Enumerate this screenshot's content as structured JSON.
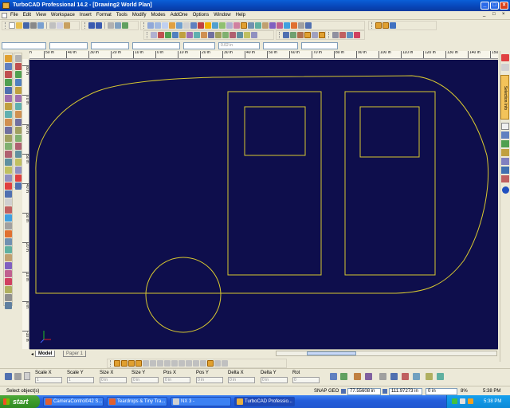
{
  "window": {
    "title": "TurboCAD Professional 14.2 - [Drawing2 World Plan]",
    "controls": [
      "_",
      "□",
      "×"
    ]
  },
  "menubar": {
    "items": [
      "File",
      "Edit",
      "View",
      "Workspace",
      "Insert",
      "Format",
      "Tools",
      "Modify",
      "Modes",
      "AddOne",
      "Options",
      "Window",
      "Help"
    ],
    "doc_controls": [
      "_",
      "□",
      "×"
    ]
  },
  "fields": {
    "linewidth": "0.02 in"
  },
  "ruler": {
    "h_labels": [
      "60 in",
      "50 in",
      "40 in",
      "30 in",
      "20 in",
      "10 in",
      "0 in",
      "10 in",
      "20 in",
      "30 in",
      "40 in",
      "50 in",
      "60 in",
      "70 in",
      "80 in",
      "90 in",
      "100 in",
      "110 in",
      "120 in",
      "130 in",
      "140 in",
      "150 in"
    ],
    "v_labels": [
      "80 in",
      "70 in",
      "60 in",
      "50 in",
      "40 in",
      "30 in",
      "20 in",
      "10 in",
      "0 in",
      "-10 in"
    ]
  },
  "right_palette": {
    "selection_info_label": "Selection Info"
  },
  "tabs": {
    "model": "Model",
    "paper": "Paper 1"
  },
  "inspector": {
    "labels": [
      "Scale X",
      "Scale Y",
      "Size X",
      "Size Y",
      "Pos X",
      "Pos Y",
      "Delta X",
      "Delta Y",
      "Rot"
    ],
    "values": [
      "1",
      "1",
      "0 in",
      "0 in",
      "0 in",
      "0 in",
      "0 in",
      "0 in",
      "0"
    ]
  },
  "status": {
    "message": "Select object(s)",
    "snap": "SNAP",
    "geo": "GEO",
    "x_coord": "77.55608 in",
    "y_coord": "111.97273 in",
    "extra": "0 in",
    "zoom": "8%",
    "time": "5:38 PM"
  },
  "taskbar": {
    "start": "start",
    "tasks": [
      "CameraControl042 S...",
      "Teardrops & Tiny Tra...",
      "NX 3 -",
      "TurboCAD Professio..."
    ],
    "clock": "5:38 PM"
  },
  "colors": {
    "canvas_bg": "#0e0e4c",
    "drawing_line": "#d8c830",
    "title_bar": "#0845b8",
    "taskbar": "#245edb",
    "start_button": "#3c9a2b"
  }
}
